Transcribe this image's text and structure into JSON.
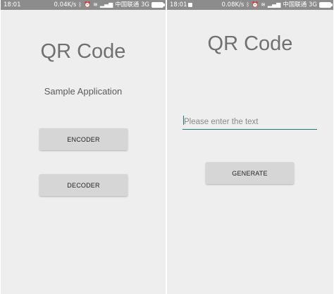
{
  "left_screen": {
    "status_bar": {
      "time": "18:01",
      "speed": "0.04K/s",
      "carrier": "中国联通 3G"
    },
    "title": "QR Code",
    "subtitle": "Sample Application",
    "encoder_label": "ENCODER",
    "decoder_label": "DECODER"
  },
  "right_screen": {
    "status_bar": {
      "time": "18:01",
      "speed": "0.08K/s",
      "carrier": "中国联通 3G"
    },
    "title": "QR Code",
    "input": {
      "placeholder": "Please enter the text",
      "value": ""
    },
    "generate_label": "GENERATE"
  },
  "icons": [
    "bluetooth-icon",
    "alarm-icon",
    "wifi-icon",
    "signal-icon",
    "battery-icon",
    "notification-icon"
  ]
}
